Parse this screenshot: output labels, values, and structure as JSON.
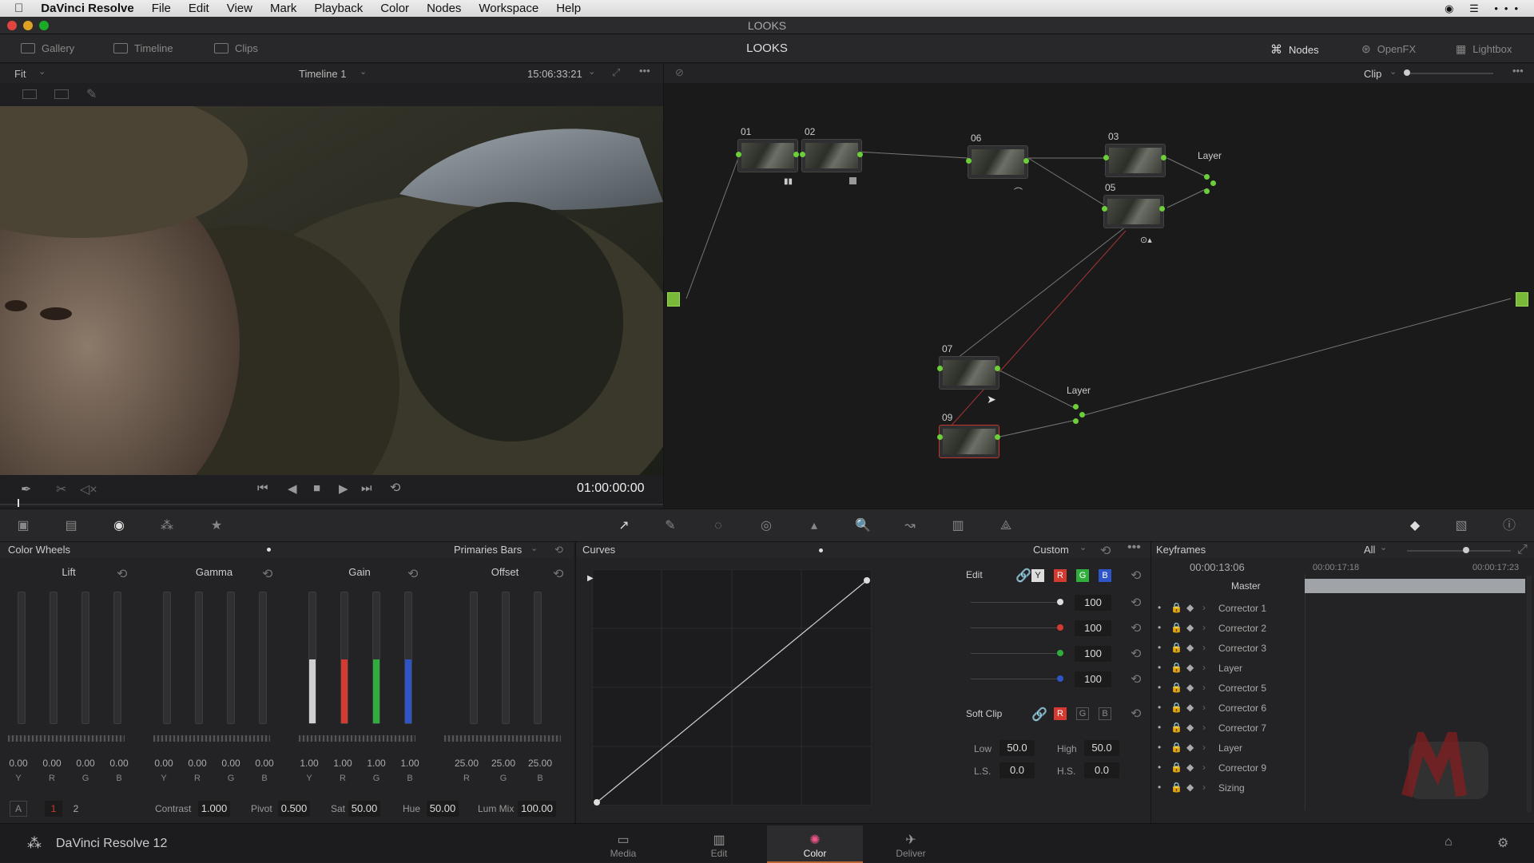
{
  "menubar": {
    "app": "DaVinci Resolve",
    "items": [
      "File",
      "Edit",
      "View",
      "Mark",
      "Playback",
      "Color",
      "Nodes",
      "Workspace",
      "Help"
    ]
  },
  "window": {
    "title": "LOOKS"
  },
  "toolbar": {
    "gallery": "Gallery",
    "timeline": "Timeline",
    "clips": "Clips",
    "title": "LOOKS",
    "nodes": "Nodes",
    "openfx": "OpenFX",
    "lightbox": "Lightbox"
  },
  "viewer": {
    "fit": "Fit",
    "timeline_name": "Timeline 1",
    "timecode": "15:06:33:21",
    "playhead_tc": "01:00:00:00"
  },
  "nodegraph": {
    "mode": "Clip",
    "node_labels": [
      "01",
      "02",
      "06",
      "03",
      "05",
      "07",
      "09"
    ],
    "layer_label": "Layer"
  },
  "colorwheels": {
    "title": "Color Wheels",
    "mode": "Primaries Bars",
    "wheels": [
      {
        "name": "Lift",
        "values": [
          "0.00",
          "0.00",
          "0.00",
          "0.00"
        ],
        "channels": [
          "Y",
          "R",
          "G",
          "B"
        ]
      },
      {
        "name": "Gamma",
        "values": [
          "0.00",
          "0.00",
          "0.00",
          "0.00"
        ],
        "channels": [
          "Y",
          "R",
          "G",
          "B"
        ]
      },
      {
        "name": "Gain",
        "values": [
          "1.00",
          "1.00",
          "1.00",
          "1.00"
        ],
        "channels": [
          "Y",
          "R",
          "G",
          "B"
        ]
      },
      {
        "name": "Offset",
        "values": [
          "25.00",
          "25.00",
          "25.00"
        ],
        "channels": [
          "R",
          "G",
          "B"
        ]
      }
    ],
    "footer": {
      "a": "A",
      "p1": "1",
      "p2": "2",
      "contrast_label": "Contrast",
      "contrast": "1.000",
      "pivot_label": "Pivot",
      "pivot": "0.500",
      "sat_label": "Sat",
      "sat": "50.00",
      "hue_label": "Hue",
      "hue": "50.00",
      "lummix_label": "Lum Mix",
      "lummix": "100.00"
    }
  },
  "curves": {
    "title": "Curves",
    "mode": "Custom",
    "edit_label": "Edit",
    "channel_buttons": [
      "Y",
      "R",
      "G",
      "B"
    ],
    "channel_values": [
      "100",
      "100",
      "100",
      "100"
    ],
    "softclip_label": "Soft Clip",
    "softclip_buttons": [
      "R",
      "G",
      "B"
    ],
    "low_label": "Low",
    "low": "50.0",
    "high_label": "High",
    "high": "50.0",
    "ls_label": "L.S.",
    "ls": "0.0",
    "hs_label": "H.S.",
    "hs": "0.0"
  },
  "keyframes": {
    "title": "Keyframes",
    "filter": "All",
    "current_tc": "00:00:13:06",
    "ruler_tc1": "00:00:17:18",
    "ruler_tc2": "00:00:17:23",
    "master": "Master",
    "tracks": [
      "Corrector 1",
      "Corrector 2",
      "Corrector 3",
      "Layer",
      "Corrector 5",
      "Corrector 6",
      "Corrector 7",
      "Layer",
      "Corrector 9",
      "Sizing"
    ]
  },
  "bottombar": {
    "product": "DaVinci Resolve 12",
    "pages": [
      "Media",
      "Edit",
      "Color",
      "Deliver"
    ]
  },
  "colors": {
    "accent": "#6ccf3a",
    "red": "#d43a2f",
    "green": "#2fae3c",
    "blue": "#2d55c8"
  }
}
